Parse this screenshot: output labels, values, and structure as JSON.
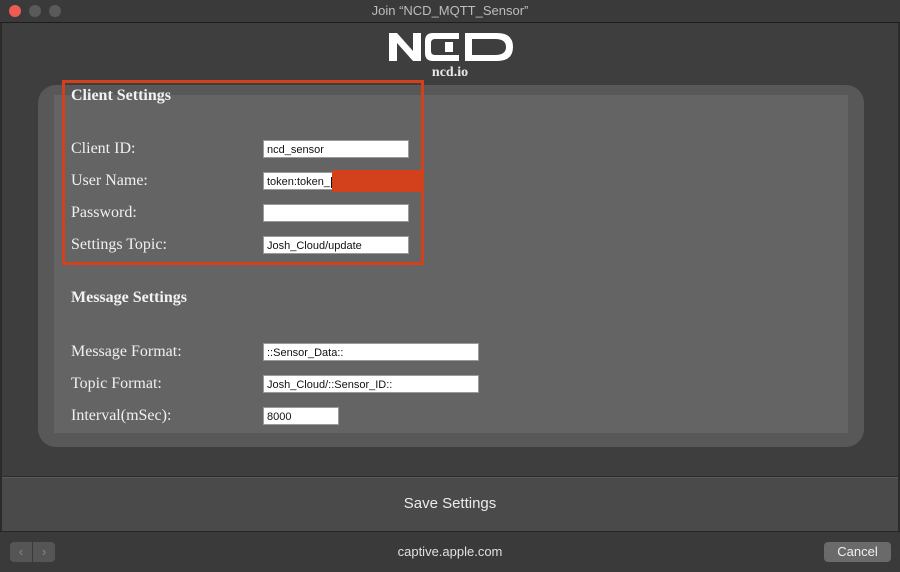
{
  "window": {
    "title": "Join “NCD_MQTT_Sensor”"
  },
  "header": {
    "logo_text": "NCD",
    "logo_subtitle": "ncd.io"
  },
  "client_settings": {
    "title": "Client Settings",
    "client_id_label": "Client ID:",
    "client_id_value": "ncd_sensor",
    "user_name_label": "User Name:",
    "user_name_value": "token:token_",
    "password_label": "Password:",
    "password_value": "",
    "settings_topic_label": "Settings Topic:",
    "settings_topic_value": "Josh_Cloud/update"
  },
  "message_settings": {
    "title": "Message Settings",
    "message_format_label": "Message Format:",
    "message_format_value": "::Sensor_Data::",
    "topic_format_label": "Topic Format:",
    "topic_format_value": "Josh_Cloud/::Sensor_ID::",
    "interval_label": "Interval(mSec):",
    "interval_value": "8000"
  },
  "actions": {
    "save_label": "Save Settings",
    "cancel_label": "Cancel"
  },
  "browser": {
    "url": "captive.apple.com",
    "back_icon": "chevron-left-icon",
    "forward_icon": "chevron-right-icon"
  },
  "colors": {
    "highlight": "#d2401c",
    "close": "#ee5b53"
  }
}
